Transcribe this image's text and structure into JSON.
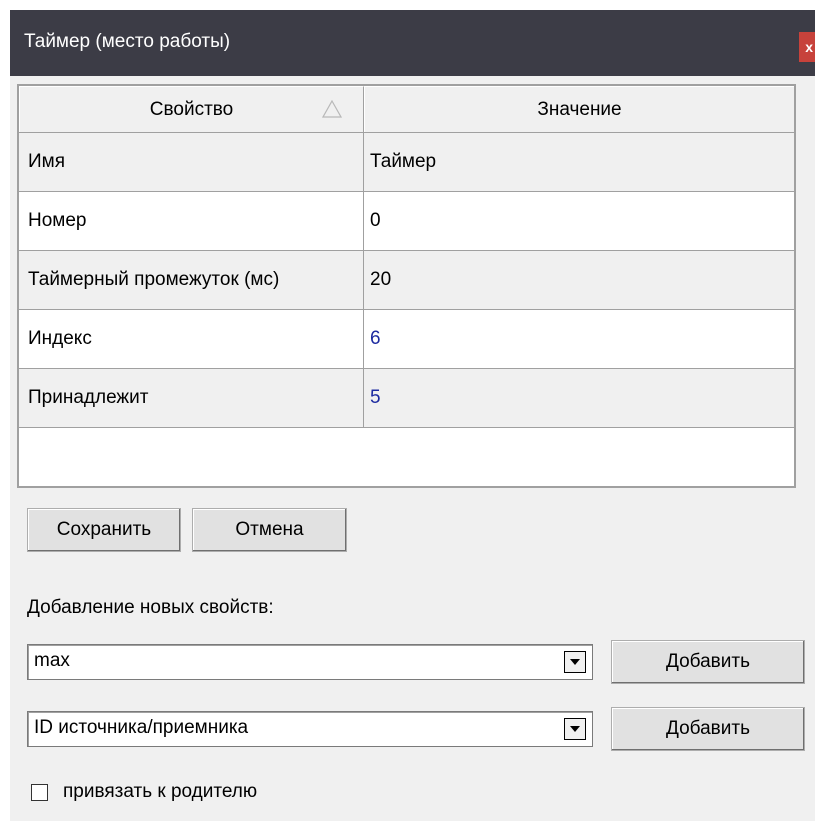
{
  "window": {
    "title": "Таймер (место работы)",
    "close_label": "x"
  },
  "grid": {
    "headers": {
      "property": "Свойство",
      "value": "Значение"
    },
    "rows": [
      {
        "key": "Имя",
        "value": "Таймер"
      },
      {
        "key": "Номер",
        "value": "0"
      },
      {
        "key": "Таймерный промежуток (мс)",
        "value": "20"
      },
      {
        "key": "Индекс",
        "value": "6"
      },
      {
        "key": "Принадлежит",
        "value": "5"
      }
    ],
    "link_color": "#1c2aa0"
  },
  "buttons": {
    "save": "Сохранить",
    "cancel": "Отмена"
  },
  "add_section": {
    "label": "Добавление новых свойств:",
    "combo1_value": "max",
    "combo2_value": "ID источника/приемника",
    "add_button": "Добавить"
  },
  "bind_parent": {
    "label": "привязать к родителю",
    "checked": false
  },
  "colors": {
    "titlebar": "#3c3c46",
    "close": "#c7423b",
    "dialog": "#f0f0f0"
  }
}
